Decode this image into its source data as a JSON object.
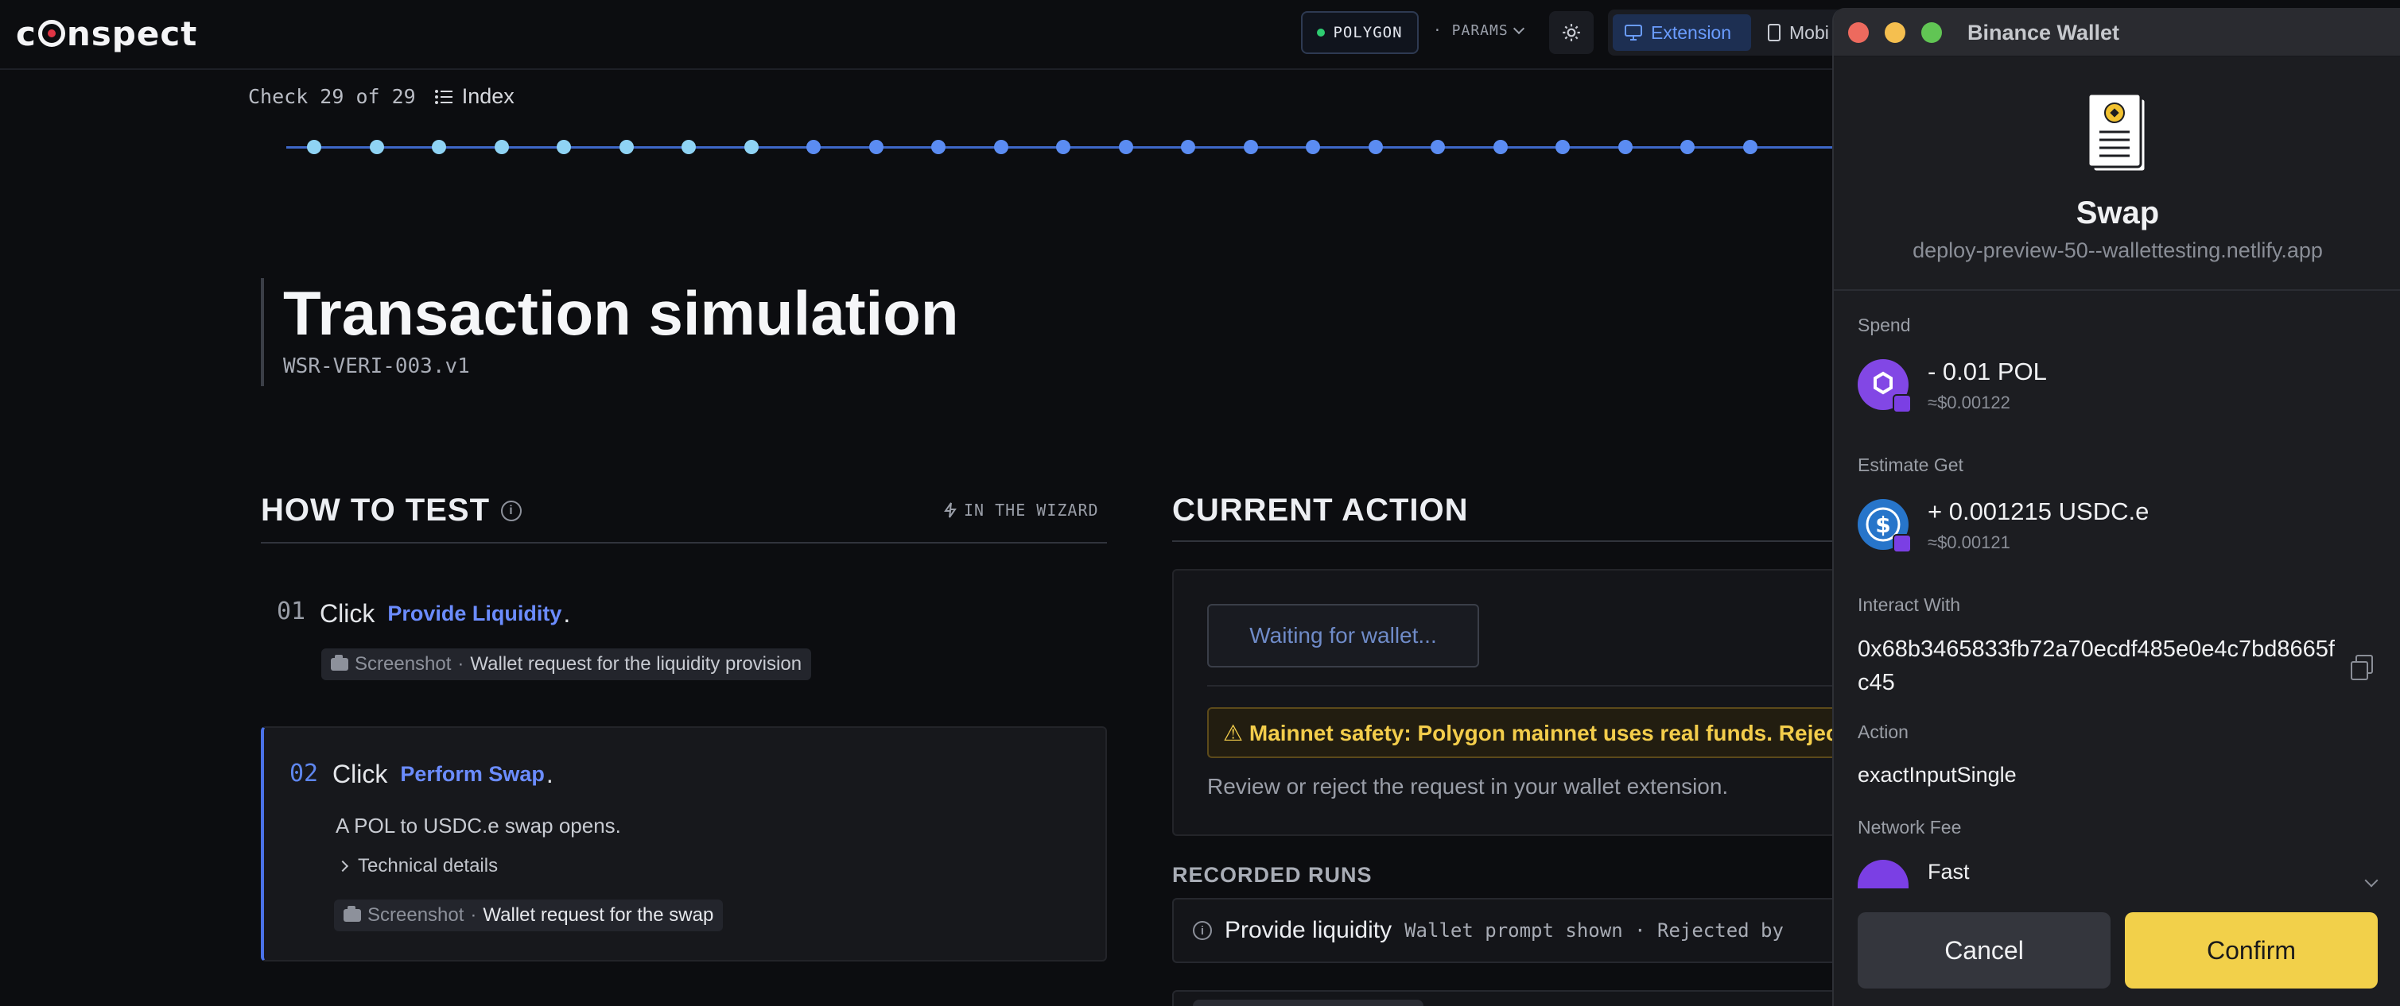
{
  "app": {
    "logo": "cinspect",
    "network": "POLYGON",
    "params_label": "· PARAMS",
    "view_extension": "Extension",
    "view_mobile": "Mobi"
  },
  "check": {
    "count": "Check 29 of 29",
    "index_label": "Index"
  },
  "progress": {
    "dots": [
      "done",
      "done",
      "done",
      "done",
      "done",
      "done",
      "done",
      "done",
      "todo",
      "todo",
      "todo",
      "todo",
      "todo",
      "todo",
      "todo",
      "todo",
      "todo",
      "todo",
      "todo",
      "todo",
      "todo",
      "todo",
      "todo",
      "todo"
    ],
    "done_color": "#8fd3f4",
    "todo_color": "#5b8cf2"
  },
  "test": {
    "title": "Transaction simulation",
    "id": "WSR-VERI-003.v1"
  },
  "how_to_test": {
    "heading": "HOW TO TEST",
    "wizard_label": "IN THE WIZARD",
    "steps": [
      {
        "num": "01",
        "verb": "Click",
        "link": "Provide Liquidity",
        "end": ".",
        "shot_label": "Screenshot",
        "shot_desc": "Wallet request for the liquidity provision"
      },
      {
        "num": "02",
        "verb": "Click",
        "link": "Perform Swap",
        "end": ".",
        "desc": "A POL to USDC.e swap opens.",
        "details": "Technical details",
        "shot_label": "Screenshot",
        "shot_desc": "Wallet request for the swap"
      }
    ]
  },
  "current_action": {
    "heading": "CURRENT ACTION",
    "waiting": "Waiting for wallet...",
    "warning": "⚠ Mainnet safety: Polygon mainnet uses real funds. Reject ev",
    "review": "Review or reject the request in your wallet extension."
  },
  "recorded_runs": {
    "heading": "RECORDED RUNS",
    "rows": [
      {
        "name": "Provide liquidity",
        "detail": "Wallet prompt shown · Rejected by"
      }
    ]
  },
  "wallet": {
    "title": "Binance Wallet",
    "action_title": "Swap",
    "origin": "deploy-preview-50--wallettesting.netlify.app",
    "spend_label": "Spend",
    "spend_amount": "- 0.01 POL",
    "spend_usd": "≈$0.00122",
    "get_label": "Estimate Get",
    "get_amount": "+ 0.001215 USDC.e",
    "get_usd": "≈$0.00121",
    "interact_label": "Interact With",
    "interact_address": "0x68b3465833fb72a70ecdf485e0e4c7bd8665fc45",
    "action_label": "Action",
    "action_value": "exactInputSingle",
    "fee_label": "Network Fee",
    "fee_value": "Fast",
    "cancel": "Cancel",
    "confirm": "Confirm",
    "confirm_color": "#f2d04a"
  }
}
